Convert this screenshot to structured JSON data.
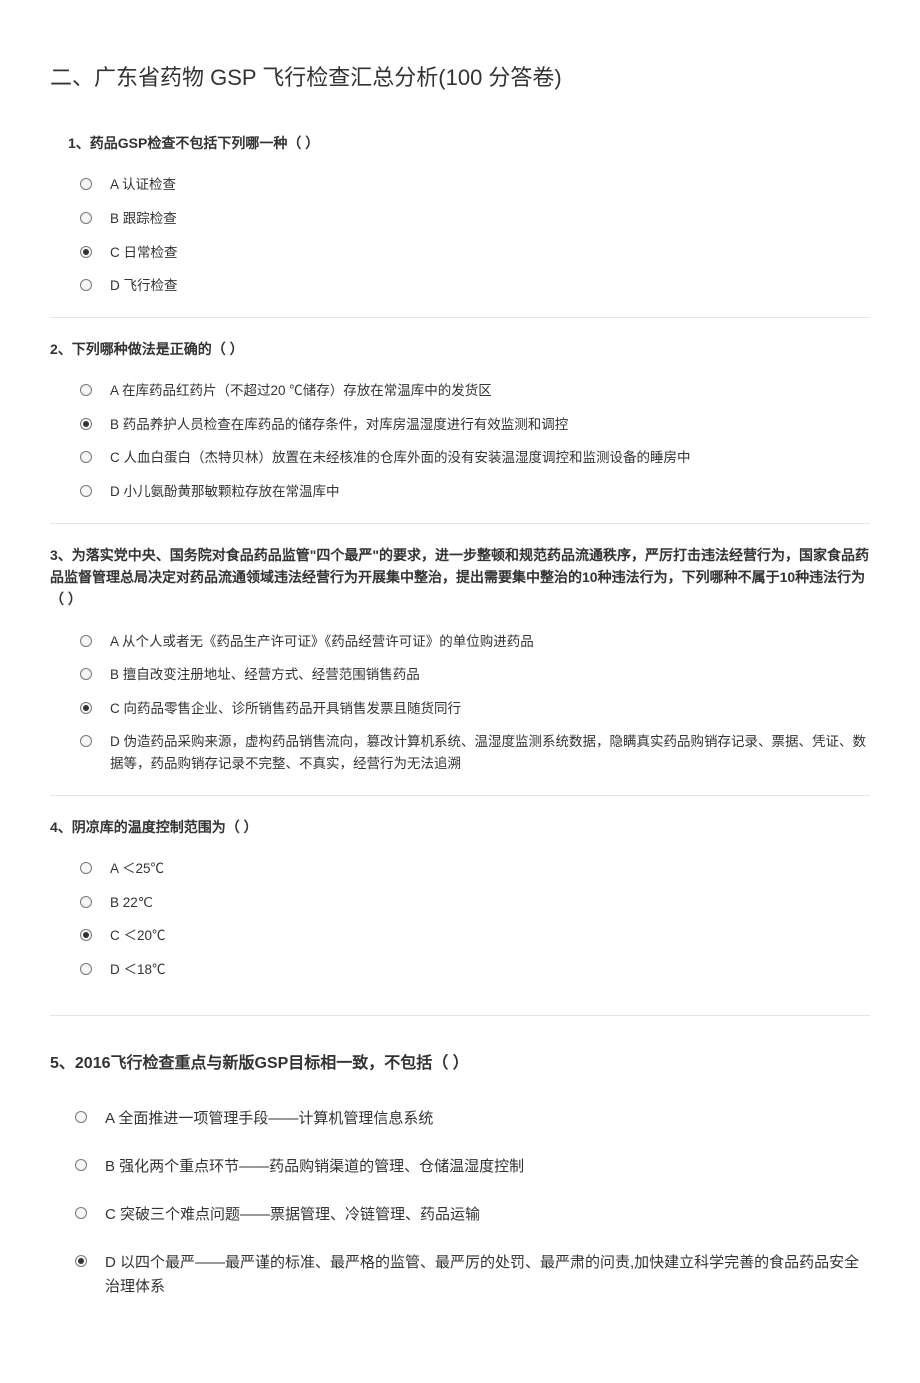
{
  "main_title": "二、广东省药物 GSP 飞行检查汇总分析(100 分答卷)",
  "questions": [
    {
      "title": "1、药品GSP检查不包括下列哪一种（ ）",
      "title_class": "small-indent",
      "selected_index": 2,
      "options": [
        "A 认证检查",
        "B 跟踪检查",
        "C 日常检查",
        "D 飞行检查"
      ]
    },
    {
      "title": "2、下列哪种做法是正确的（ ）",
      "title_class": "no-indent",
      "selected_index": 1,
      "options": [
        "A 在库药品红药片（不超过20 ℃储存）存放在常温库中的发货区",
        "B 药品养护人员检查在库药品的储存条件，对库房温湿度进行有效监测和调控",
        "C 人血白蛋白（杰特贝林）放置在未经核准的仓库外面的没有安装温湿度调控和监测设备的睡房中",
        "D 小儿氨酚黄那敏颗粒存放在常温库中"
      ]
    },
    {
      "title": "3、为落实党中央、国务院对食品药品监管\"四个最严\"的要求，进一步整顿和规范药品流通秩序，严厉打击违法经营行为，国家食品药品监督管理总局决定对药品流通领域违法经营行为开展集中整治，提出需要集中整治的10种违法行为，下列哪种不属于10种违法行为（ ）",
      "title_class": "no-indent",
      "selected_index": 2,
      "options": [
        "A 从个人或者无《药品生产许可证》《药品经营许可证》的单位购进药品",
        "B 擅自改变注册地址、经营方式、经营范围销售药品",
        "C 向药品零售企业、诊所销售药品开具销售发票且随货同行",
        "D 伪造药品采购来源，虚构药品销售流向，篡改计算机系统、温湿度监测系统数据，隐瞒真实药品购销存记录、票据、凭证、数据等，药品购销存记录不完整、不真实，经营行为无法追溯"
      ]
    },
    {
      "title": "4、阴凉库的温度控制范围为（ ）",
      "title_class": "no-indent",
      "block_class": "large-gap",
      "selected_index": 2,
      "options": [
        "A ＜25℃",
        "B 22℃",
        "C ＜20℃",
        "D ＜18℃"
      ]
    },
    {
      "title": "5、2016飞行检查重点与新版GSP目标相一致，不包括（ ）",
      "title_class": "no-indent",
      "block_class": "q5",
      "selected_index": 3,
      "options": [
        "A 全面推进一项管理手段――计算机管理信息系统",
        "B 强化两个重点环节――药品购销渠道的管理、仓储温湿度控制",
        "C 突破三个难点问题――票据管理、冷链管理、药品运输",
        "D 以四个最严――最严谨的标准、最严格的监管、最严厉的处罚、最严肃的问责,加快建立科学完善的食品药品安全治理体系"
      ]
    }
  ]
}
